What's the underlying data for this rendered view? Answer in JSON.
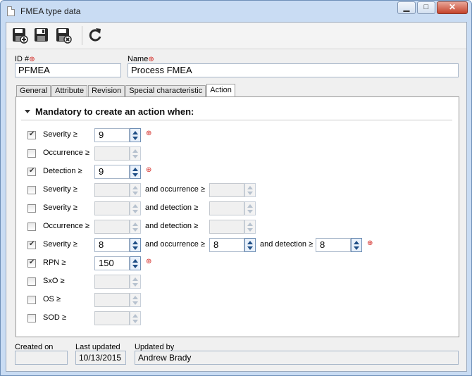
{
  "window": {
    "title": "FMEA type data",
    "minimize_glyph": "▁",
    "maximize_glyph": "□",
    "close_glyph": "✕"
  },
  "toolbar": {
    "buttons": [
      "save-new-icon",
      "save-icon",
      "save-close-icon",
      "refresh-icon"
    ]
  },
  "fields": {
    "id_label": "ID #",
    "id_value": "PFMEA",
    "name_label": "Name",
    "name_value": "Process FMEA",
    "required_mark": "⊕"
  },
  "tabs": [
    {
      "label": "General",
      "active": false
    },
    {
      "label": "Attribute",
      "active": false
    },
    {
      "label": "Revision",
      "active": false
    },
    {
      "label": "Special characteristic",
      "active": false
    },
    {
      "label": "Action",
      "active": true
    }
  ],
  "section": {
    "title": "Mandatory to create an action when:"
  },
  "rows": [
    {
      "checked": true,
      "label": "Severity ≥",
      "value": "9",
      "enabled": true,
      "required": true
    },
    {
      "checked": false,
      "label": "Occurrence ≥",
      "value": "",
      "enabled": false,
      "required": false
    },
    {
      "checked": true,
      "label": "Detection ≥",
      "value": "9",
      "enabled": true,
      "required": true
    },
    {
      "checked": false,
      "label": "Severity ≥",
      "value": "",
      "enabled": false,
      "and1_label": "and occurrence ≥",
      "and1_value": ""
    },
    {
      "checked": false,
      "label": "Severity ≥",
      "value": "",
      "enabled": false,
      "and1_label": "and detection ≥",
      "and1_value": ""
    },
    {
      "checked": false,
      "label": "Occurrence ≥",
      "value": "",
      "enabled": false,
      "and1_label": "and detection ≥",
      "and1_value": ""
    },
    {
      "checked": true,
      "label": "Severity ≥",
      "value": "8",
      "enabled": true,
      "and1_label": "and occurrence ≥",
      "and1_value": "8",
      "and2_label": "and detection ≥",
      "and2_value": "8",
      "required": true
    },
    {
      "checked": true,
      "label": "RPN ≥",
      "value": "150",
      "enabled": true,
      "required": true
    },
    {
      "checked": false,
      "label": "SxO ≥",
      "value": "",
      "enabled": false
    },
    {
      "checked": false,
      "label": "OS ≥",
      "value": "",
      "enabled": false
    },
    {
      "checked": false,
      "label": "SOD ≥",
      "value": "",
      "enabled": false
    }
  ],
  "footer": {
    "created_label": "Created on",
    "created_value": "",
    "updated_label": "Last updated",
    "updated_value": "10/13/2015",
    "updated_by_label": "Updated by",
    "updated_by_value": "Andrew Brady"
  }
}
